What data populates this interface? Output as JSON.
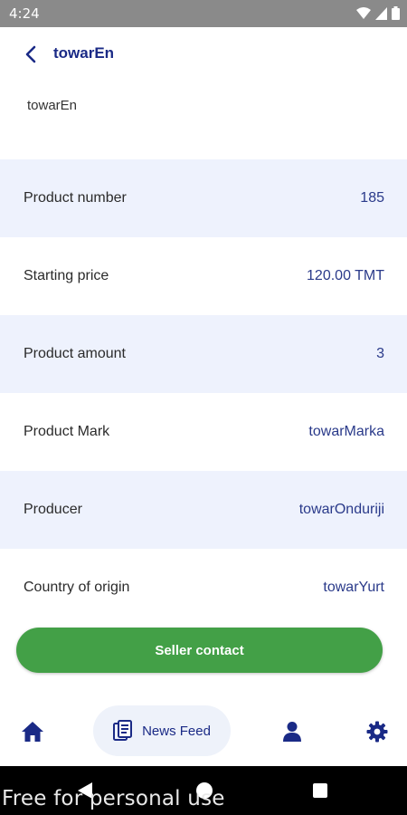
{
  "status_bar": {
    "time": "4:24"
  },
  "app_bar": {
    "title": "towarEn"
  },
  "product": {
    "name": "towarEn"
  },
  "details": [
    {
      "label": "Product number",
      "value": "185"
    },
    {
      "label": "Starting price",
      "value": "120.00 TMT"
    },
    {
      "label": "Product amount",
      "value": "3"
    },
    {
      "label": "Product Mark",
      "value": "towarMarka"
    },
    {
      "label": "Producer",
      "value": "towarOnduriji"
    },
    {
      "label": "Country of origin",
      "value": "towarYurt"
    }
  ],
  "actions": {
    "seller_contact": "Seller contact"
  },
  "bottom_nav": {
    "items": [
      {
        "icon": "home-icon",
        "label": ""
      },
      {
        "icon": "news-feed-icon",
        "label": "News Feed"
      },
      {
        "icon": "profile-icon",
        "label": ""
      },
      {
        "icon": "settings-icon",
        "label": ""
      }
    ]
  },
  "watermark": "Free for personal use",
  "colors": {
    "accent": "#1a2a86",
    "row_shade": "#eef2fd",
    "button_green": "#43a047",
    "status_bar": "#8a8a8a"
  }
}
